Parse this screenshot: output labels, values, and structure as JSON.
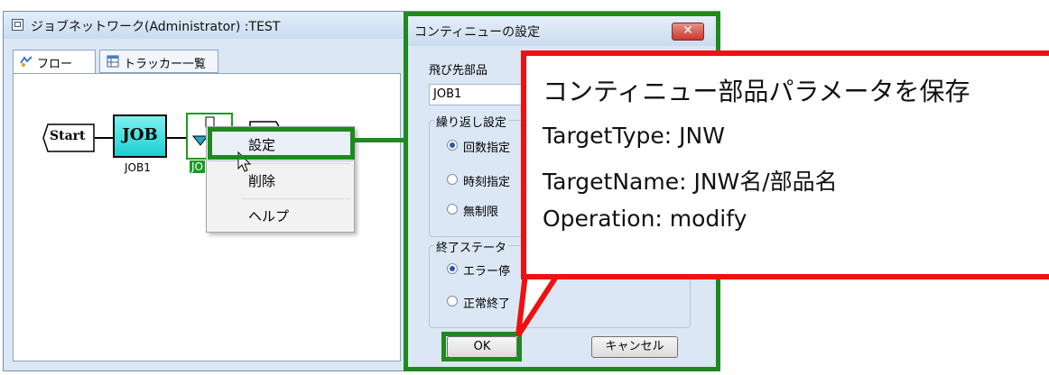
{
  "window": {
    "title": "ジョブネットワーク(Administrator) :TEST"
  },
  "tabs": [
    {
      "label": "フロー"
    },
    {
      "label": "トラッカー一覧"
    }
  ],
  "flow": {
    "start_label": "Start",
    "job_text": "JOB",
    "job_name": "JOB1",
    "continue_name_partial": "JO"
  },
  "context_menu": {
    "items": [
      {
        "label": "設定"
      },
      {
        "label": "削除"
      },
      {
        "label": "ヘルプ"
      }
    ]
  },
  "dialog": {
    "title": "コンティニューの設定",
    "close_label": "✕",
    "jump_target_label": "飛び先部品",
    "jump_target_value": "JOB1",
    "repeat_group_label": "繰り返し設定",
    "repeat_options": [
      {
        "label": "回数指定",
        "selected": true
      },
      {
        "label": "時刻指定",
        "selected": false
      },
      {
        "label": "無制限",
        "selected": false
      }
    ],
    "end_status_label": "終了ステータ",
    "end_options": [
      {
        "label": "エラー停",
        "selected": true
      },
      {
        "label": "正常終了",
        "selected": false
      }
    ],
    "ok_label": "OK",
    "cancel_label": "キャンセル"
  },
  "callout": {
    "title": "コンティニュー部品パラメータを保存",
    "lines": [
      "TargetType: JNW",
      "TargetName: JNW名/部品名",
      "Operation: modify"
    ]
  },
  "colors": {
    "highlight_green": "#1e8a1e",
    "callout_red": "#ee1111",
    "job_fill": "#1ccfd2"
  }
}
